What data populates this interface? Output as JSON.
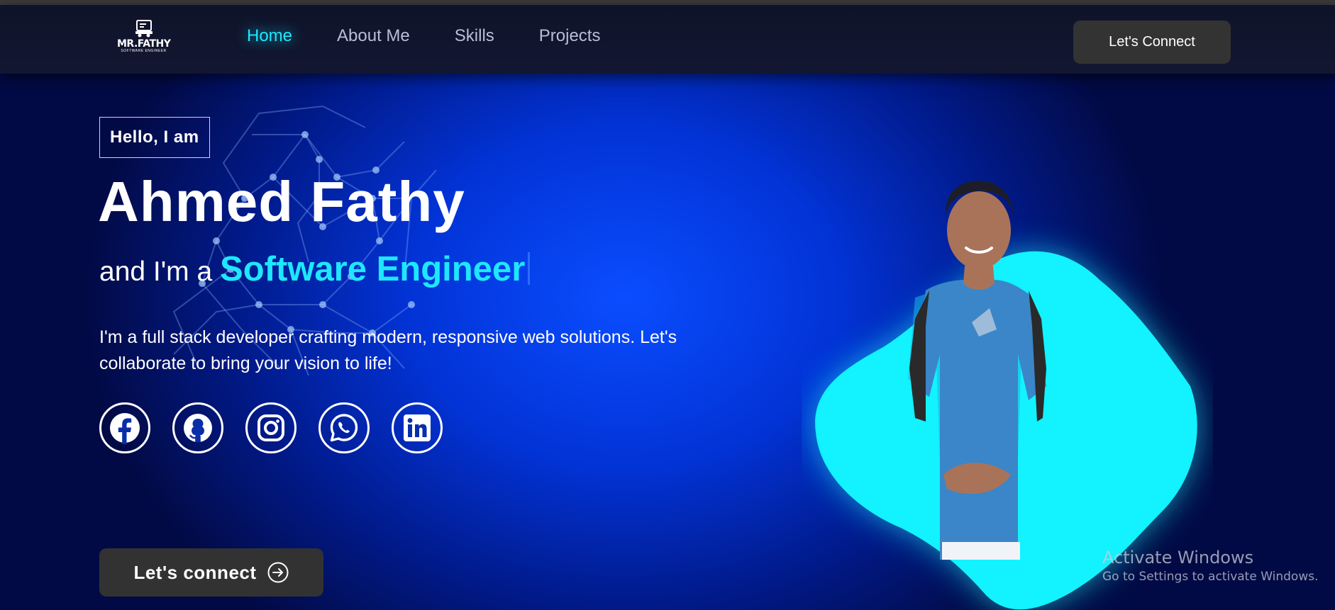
{
  "nav": {
    "logo": {
      "brand": "MR.FATHY",
      "tagline": "SOFTWARE ENGINEER"
    },
    "links": [
      {
        "label": "Home",
        "active": true
      },
      {
        "label": "About Me",
        "active": false
      },
      {
        "label": "Skills",
        "active": false
      },
      {
        "label": "Projects",
        "active": false
      }
    ],
    "connect_label": "Let's Connect"
  },
  "hero": {
    "greeting": "Hello, I am",
    "name": "Ahmed Fathy",
    "role_prefix": "and I'm a",
    "role": "Software Engineer",
    "bio": "I'm a full stack developer crafting modern, responsive web solutions. Let's collaborate to bring your vision to life!",
    "socials": [
      {
        "icon": "facebook-icon"
      },
      {
        "icon": "github-icon"
      },
      {
        "icon": "instagram-icon"
      },
      {
        "icon": "whatsapp-icon"
      },
      {
        "icon": "linkedin-icon"
      }
    ],
    "cta_label": "Let's connect",
    "cta_icon": "arrow-right-circle-icon"
  },
  "os_watermark": {
    "title": "Activate Windows",
    "subtitle": "Go to Settings to activate Windows."
  },
  "colors": {
    "accent": "#1ee7ff",
    "background": "#0233d6",
    "nav_bg": "#121631",
    "button_bg": "#333333",
    "blob": "#12f2ff"
  }
}
